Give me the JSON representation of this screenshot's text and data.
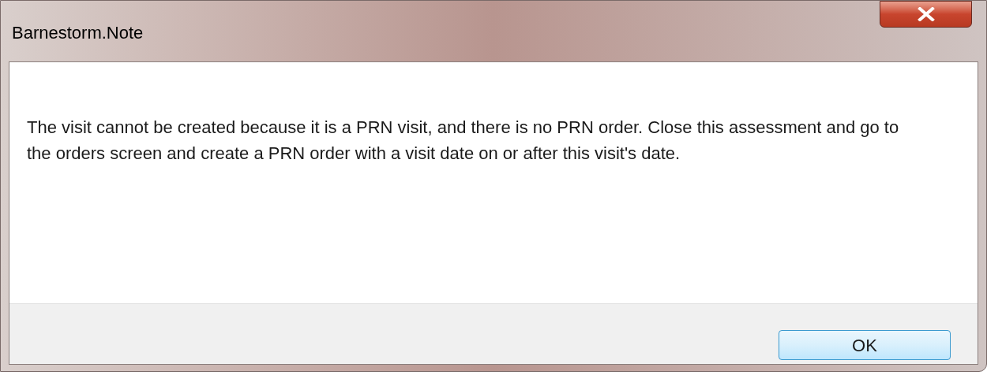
{
  "window": {
    "title": "Barnestorm.Note"
  },
  "message": "The visit cannot be created because it is a PRN visit, and there is no PRN order. Close this assessment and go to the orders screen and create a PRN order with a visit date on or after this visit's date.",
  "buttons": [
    "OK"
  ]
}
